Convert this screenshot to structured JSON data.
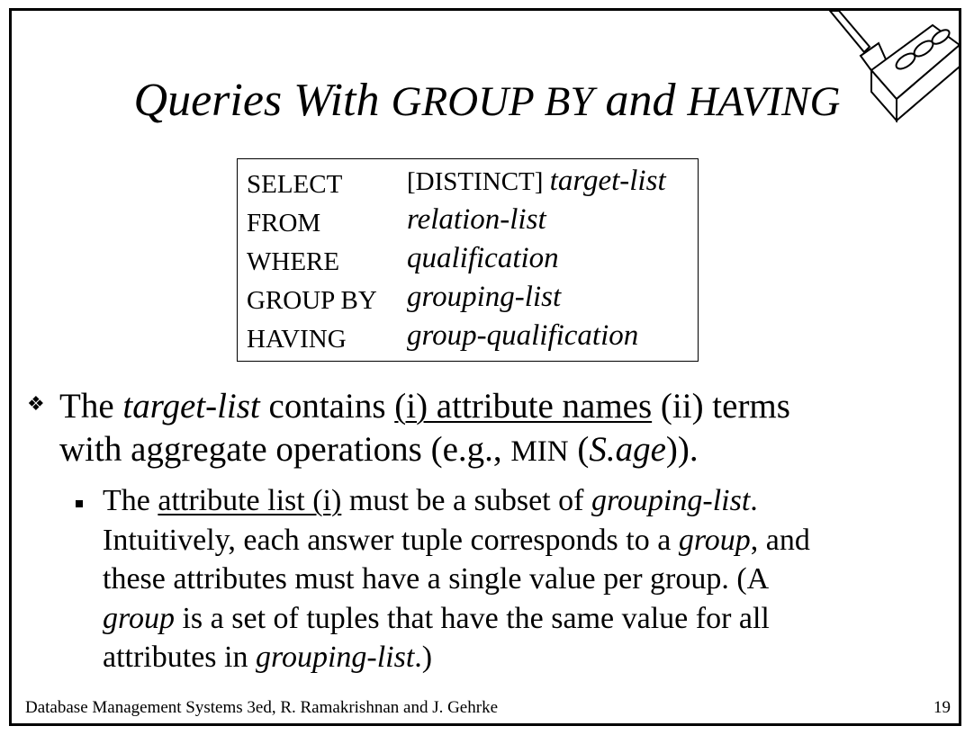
{
  "slide": {
    "title": {
      "part1": "Queries With ",
      "part2": "GROUP BY",
      "part3": " and ",
      "part4": "HAVING"
    },
    "syntax": [
      {
        "kw": "SELECT",
        "pre": "[DISTINCT] ",
        "val": "target-list"
      },
      {
        "kw": "FROM",
        "pre": "",
        "val": "relation-list"
      },
      {
        "kw": "WHERE",
        "pre": "",
        "val": "qualification"
      },
      {
        "kw": "GROUP BY",
        "pre": "",
        "val": "grouping-list"
      },
      {
        "kw": "HAVING",
        "pre": "",
        "val": "group-qualification"
      }
    ],
    "bullet1": {
      "marker": "❖",
      "l1_a": "The ",
      "l1_b": "target-list",
      "l1_c": " contains ",
      "l1_d": "(i) attribute names",
      "l1_e": "  (ii) terms",
      "l2_a": "with aggregate operations (e.g., ",
      "l2_b": "MIN",
      "l2_c": " (",
      "l2_d": "S.age",
      "l2_e": "))."
    },
    "bullet2": {
      "l1_a": "The ",
      "l1_b": "attribute list (i)",
      "l1_c": " must be a subset of ",
      "l1_d": "grouping-list",
      "l1_e": ".",
      "l2_a": "Intuitively, each answer tuple corresponds to a ",
      "l2_b": "group",
      "l2_c": ", and",
      "l3": "these attributes must have a single value per group.  (A",
      "l4_a": "group",
      "l4_b": " is a set of tuples that have the same value for all",
      "l5_a": "attributes in ",
      "l5_b": "grouping-list",
      "l5_c": ".)"
    },
    "footer": {
      "source": "Database Management Systems 3ed,  R. Ramakrishnan and J. Gehrke",
      "page": "19"
    }
  }
}
